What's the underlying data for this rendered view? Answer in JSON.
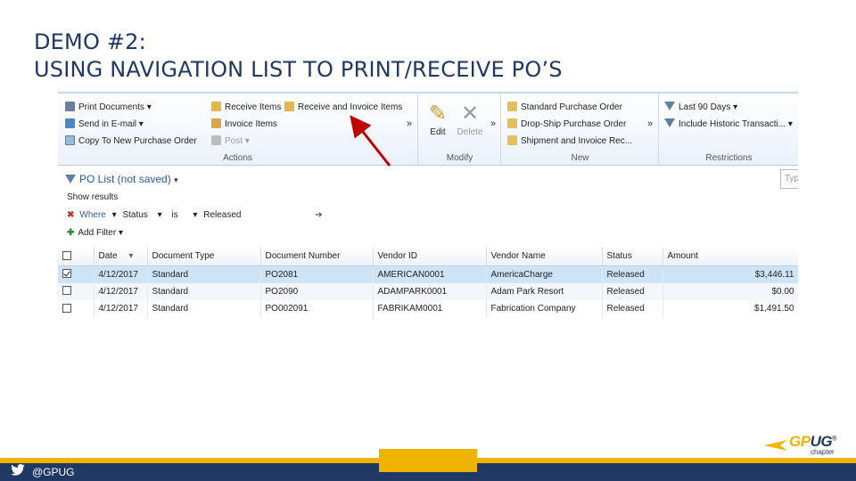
{
  "slide": {
    "title_line1": "DEMO #2:",
    "title_line2": "USING NAVIGATION LIST TO PRINT/RECEIVE PO’S",
    "twitter_handle": "@GPUG",
    "logo_gp": "GP",
    "logo_ug": "UG",
    "logo_tm": "®",
    "logo_sub": "chapter"
  },
  "ribbon": {
    "groups": {
      "actions": {
        "label": "Actions",
        "print_documents": "Print Documents",
        "send_in_email": "Send in E-mail",
        "copy_to_new_po": "Copy To New Purchase Order",
        "receive_items": "Receive Items",
        "invoice_items": "Invoice Items",
        "post": "Post",
        "receive_and_invoice_items": "Receive and Invoice Items"
      },
      "modify": {
        "label": "Modify",
        "edit": "Edit",
        "delete": "Delete"
      },
      "new": {
        "label": "New",
        "standard_po": "Standard Purchase Order",
        "drop_ship_po": "Drop-Ship Purchase Order",
        "shipment_invoice": "Shipment and Invoice Rec..."
      },
      "restrictions": {
        "label": "Restrictions",
        "last_90_days": "Last 90 Days",
        "include_historic": "Include Historic Transacti..."
      }
    },
    "more_glyph": "»"
  },
  "list": {
    "title": "PO List (not saved)",
    "show_results": "Show results",
    "where": "Where",
    "filter_field": "Status",
    "filter_op": "is",
    "filter_value": "Released",
    "add_filter": "Add Filter",
    "search_placeholder": "Typ"
  },
  "grid": {
    "columns": [
      "Date",
      "Document Type",
      "Document Number",
      "Vendor ID",
      "Vendor Name",
      "Status",
      "Amount"
    ],
    "rows": [
      {
        "checked": true,
        "date": "4/12/2017",
        "doc_type": "Standard",
        "doc_number": "PO2081",
        "vendor_id": "AMERICAN0001",
        "vendor_name": "AmericaCharge",
        "status": "Released",
        "amount": "$3,446.11"
      },
      {
        "checked": false,
        "date": "4/12/2017",
        "doc_type": "Standard",
        "doc_number": "PO2090",
        "vendor_id": "ADAMPARK0001",
        "vendor_name": "Adam Park Resort",
        "status": "Released",
        "amount": "$0.00"
      },
      {
        "checked": false,
        "date": "4/12/2017",
        "doc_type": "Standard",
        "doc_number": "PO002091",
        "vendor_id": "FABRIKAM0001",
        "vendor_name": "Fabrication Company",
        "status": "Released",
        "amount": "$1,491.50"
      }
    ]
  },
  "colors": {
    "title": "#1f3864",
    "accent_gold": "#f0b400",
    "footer_navy": "#1f3864",
    "arrow_red": "#c00000",
    "selected_row": "#cde4f7"
  },
  "icons": [
    "print-icon",
    "email-icon",
    "copy-icon",
    "receive-icon",
    "invoice-icon",
    "post-icon",
    "edit-icon",
    "delete-icon",
    "new-po-icon",
    "filter-icon",
    "twitter-icon"
  ]
}
